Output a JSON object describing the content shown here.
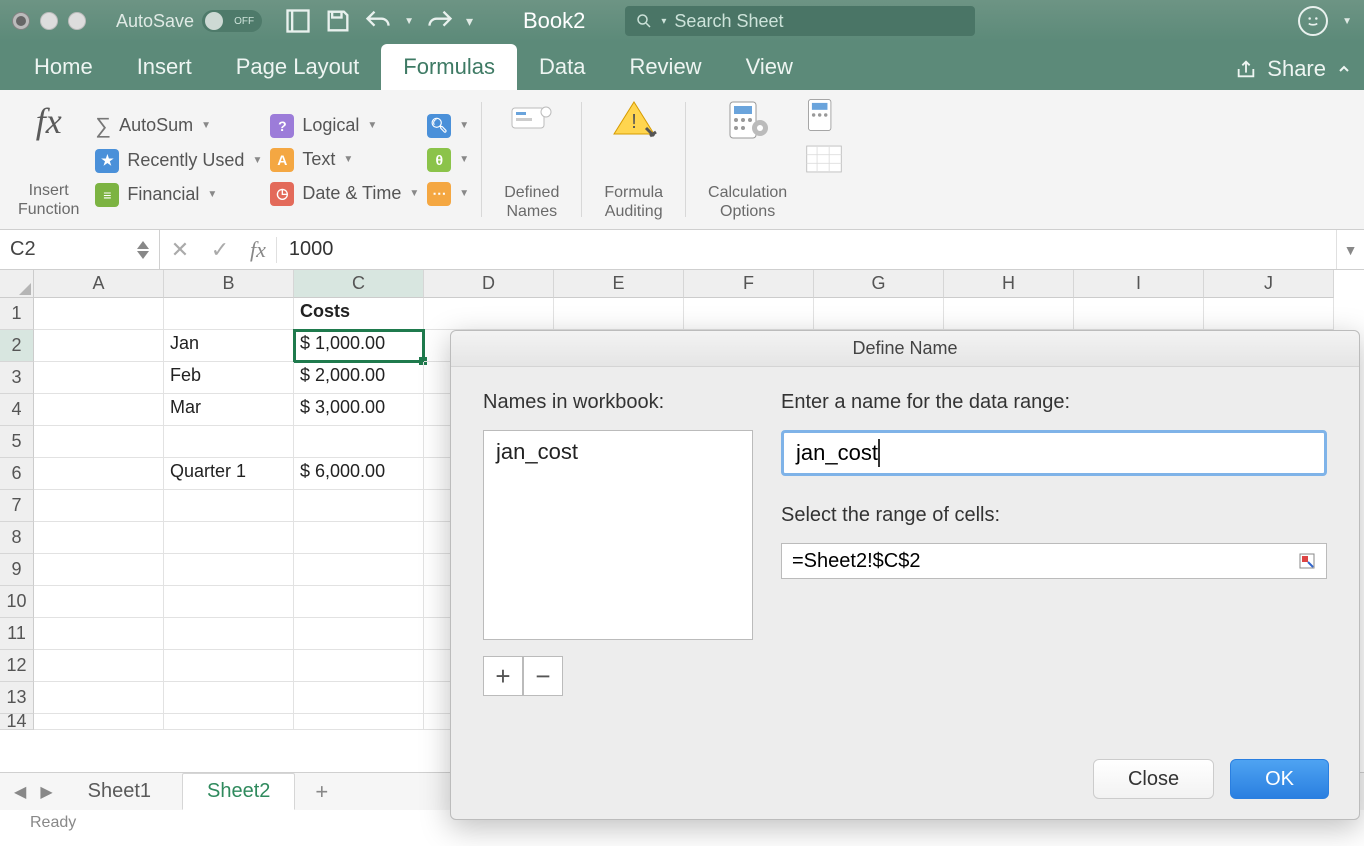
{
  "titlebar": {
    "autosave_label": "AutoSave",
    "autosave_state": "OFF",
    "document_title": "Book2",
    "search_placeholder": "Search Sheet"
  },
  "tabs": {
    "items": [
      "Home",
      "Insert",
      "Page Layout",
      "Formulas",
      "Data",
      "Review",
      "View"
    ],
    "active": "Formulas",
    "share": "Share"
  },
  "ribbon": {
    "insert_function": "Insert\nFunction",
    "autosum": "AutoSum",
    "recently_used": "Recently Used",
    "financial": "Financial",
    "logical": "Logical",
    "text": "Text",
    "date_time": "Date & Time",
    "defined_names": "Defined\nNames",
    "formula_auditing": "Formula\nAuditing",
    "calculation_options": "Calculation\nOptions"
  },
  "formula_bar": {
    "name_box": "C2",
    "formula": "1000"
  },
  "grid": {
    "columns": [
      "A",
      "B",
      "C",
      "D",
      "E",
      "F",
      "G",
      "H",
      "I",
      "J"
    ],
    "selected_col": "C",
    "selected_row": 2,
    "rows": [
      {
        "n": 1,
        "B": "",
        "C_header": "Costs"
      },
      {
        "n": 2,
        "B": "Jan",
        "C": "$ 1,000.00"
      },
      {
        "n": 3,
        "B": "Feb",
        "C": "$ 2,000.00"
      },
      {
        "n": 4,
        "B": "Mar",
        "C": "$ 3,000.00"
      },
      {
        "n": 5,
        "B": "",
        "C": ""
      },
      {
        "n": 6,
        "B": "Quarter 1",
        "C": "$ 6,000.00"
      },
      {
        "n": 7
      },
      {
        "n": 8
      },
      {
        "n": 9
      },
      {
        "n": 10
      },
      {
        "n": 11
      },
      {
        "n": 12
      },
      {
        "n": 13
      },
      {
        "n": 14
      }
    ]
  },
  "sheet_tabs": {
    "items": [
      "Sheet1",
      "Sheet2"
    ],
    "active": "Sheet2"
  },
  "status": "Ready",
  "dialog": {
    "title": "Define Name",
    "names_label": "Names in workbook:",
    "names_list": [
      "jan_cost"
    ],
    "enter_name_label": "Enter a name for the data range:",
    "name_value": "jan_cost",
    "select_range_label": "Select the range of cells:",
    "range_value": "=Sheet2!$C$2",
    "close": "Close",
    "ok": "OK"
  }
}
